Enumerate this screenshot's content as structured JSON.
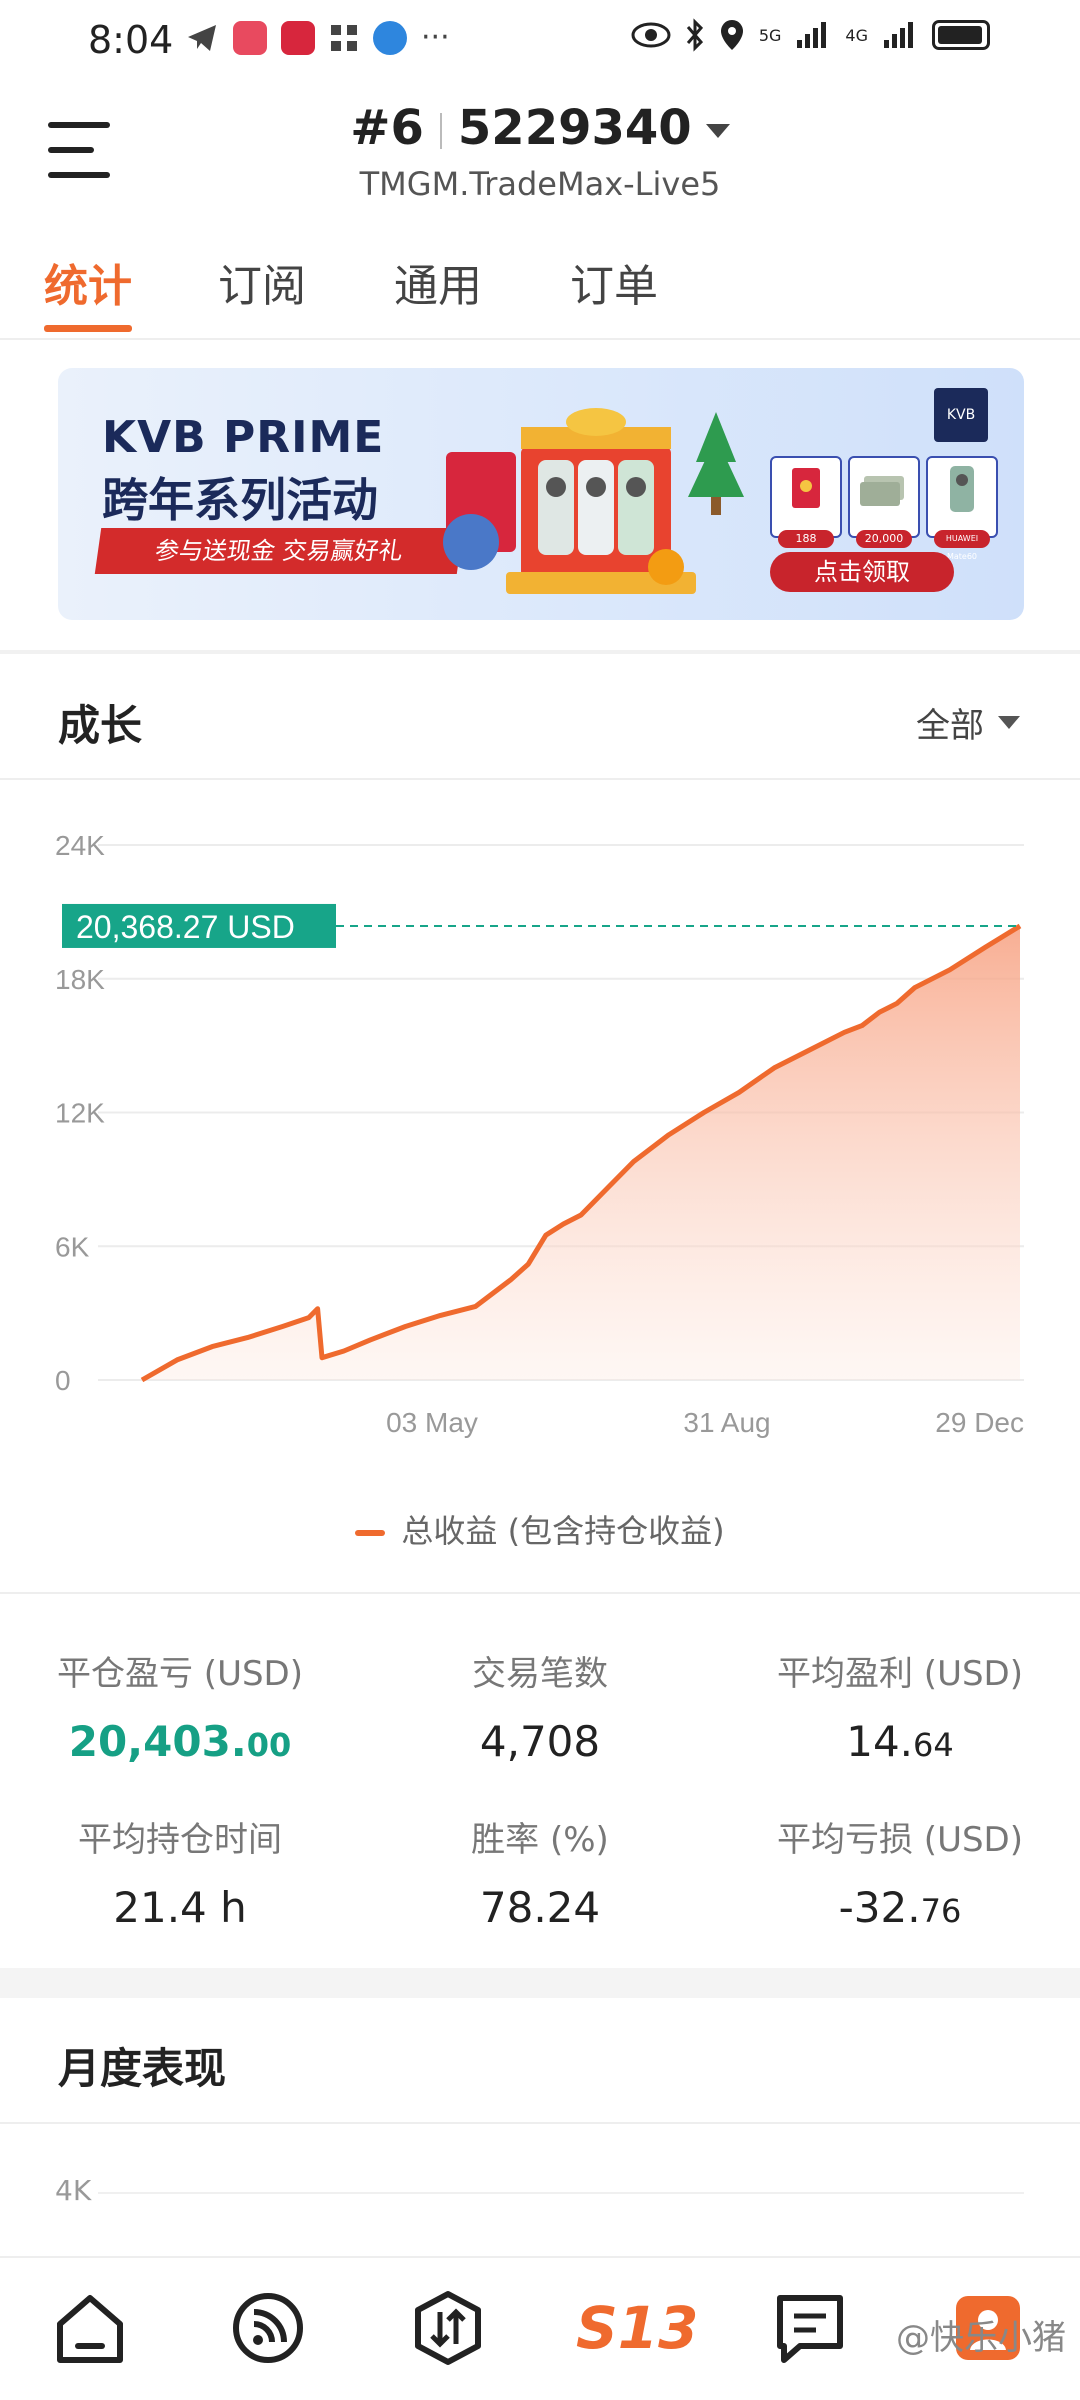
{
  "status_bar": {
    "time": "8:04",
    "network_labels": [
      "5G",
      "4G"
    ]
  },
  "header": {
    "rank": "#6",
    "account_number": "5229340",
    "server": "TMGM.TradeMax-Live5",
    "menu_icon": "hamburger-menu-icon"
  },
  "tabs": [
    {
      "label": "统计",
      "active": true
    },
    {
      "label": "订阅",
      "active": false
    },
    {
      "label": "通用",
      "active": false
    },
    {
      "label": "订单",
      "active": false
    }
  ],
  "banner": {
    "brand": "KVB PRIME",
    "headline": "跨年系列活动",
    "ribbon_text": "参与送现金 交易赢好礼",
    "logo_text": "KVB",
    "prize_values": [
      "188",
      "20,000",
      "HUAWEI Mate60"
    ],
    "cta_label": "点击领取"
  },
  "growth": {
    "title": "成长",
    "filter_label": "全部",
    "current_value_label": "20,368.27 USD",
    "accent_color": "#ef6a2e",
    "value_tag_color": "#17a589"
  },
  "chart_data": {
    "type": "area",
    "y_ticks": [
      "24K",
      "18K",
      "12K",
      "6K",
      "0"
    ],
    "x_ticks": [
      "03 May",
      "31 Aug",
      "29 Dec"
    ],
    "ylim": [
      0,
      24000
    ],
    "series": [
      {
        "name": "总收益 (包含持仓收益)",
        "x": [
          0,
          0.04,
          0.08,
          0.12,
          0.16,
          0.19,
          0.2,
          0.205,
          0.23,
          0.26,
          0.3,
          0.34,
          0.38,
          0.42,
          0.44,
          0.46,
          0.48,
          0.5,
          0.53,
          0.56,
          0.6,
          0.64,
          0.68,
          0.72,
          0.76,
          0.8,
          0.82,
          0.84,
          0.86,
          0.88,
          0.92,
          0.96,
          1.0
        ],
        "values": [
          0,
          900,
          1500,
          1900,
          2400,
          2800,
          3200,
          1000,
          1300,
          1800,
          2400,
          2900,
          3300,
          4500,
          5200,
          6500,
          7000,
          7400,
          8600,
          9800,
          11000,
          12000,
          12900,
          14000,
          14800,
          15600,
          15900,
          16500,
          16900,
          17600,
          18400,
          19400,
          20368
        ]
      }
    ],
    "reference_line_value": 20368.27,
    "grid": true,
    "legend_position": "bottom"
  },
  "legend": {
    "label": "总收益 (包含持仓收益)"
  },
  "stats": [
    {
      "label": "平仓盈亏 (USD)",
      "value_int": "20,403.",
      "value_dec": "00",
      "highlight": true
    },
    {
      "label": "交易笔数",
      "value_int": "4,708",
      "value_dec": "",
      "highlight": false
    },
    {
      "label": "平均盈利 (USD)",
      "value_int": "14.",
      "value_dec": "64",
      "highlight": false
    },
    {
      "label": "平均持仓时间",
      "value_int": "21.4 h",
      "value_dec": "",
      "highlight": false
    },
    {
      "label": "胜率 (%)",
      "value_int": "78.24",
      "value_dec": "",
      "highlight": false
    },
    {
      "label": "平均亏损 (USD)",
      "value_int": "-32.",
      "value_dec": "76",
      "highlight": false
    }
  ],
  "monthly": {
    "title": "月度表现",
    "first_tick": "4K"
  },
  "bottom_nav": [
    {
      "icon": "home-icon"
    },
    {
      "icon": "signal-feed-icon"
    },
    {
      "icon": "trade-arrows-icon"
    },
    {
      "icon": "s13-logo-icon",
      "label": "S13"
    },
    {
      "icon": "message-icon"
    },
    {
      "icon": "profile-icon"
    }
  ],
  "watermark": "@快乐小猪"
}
